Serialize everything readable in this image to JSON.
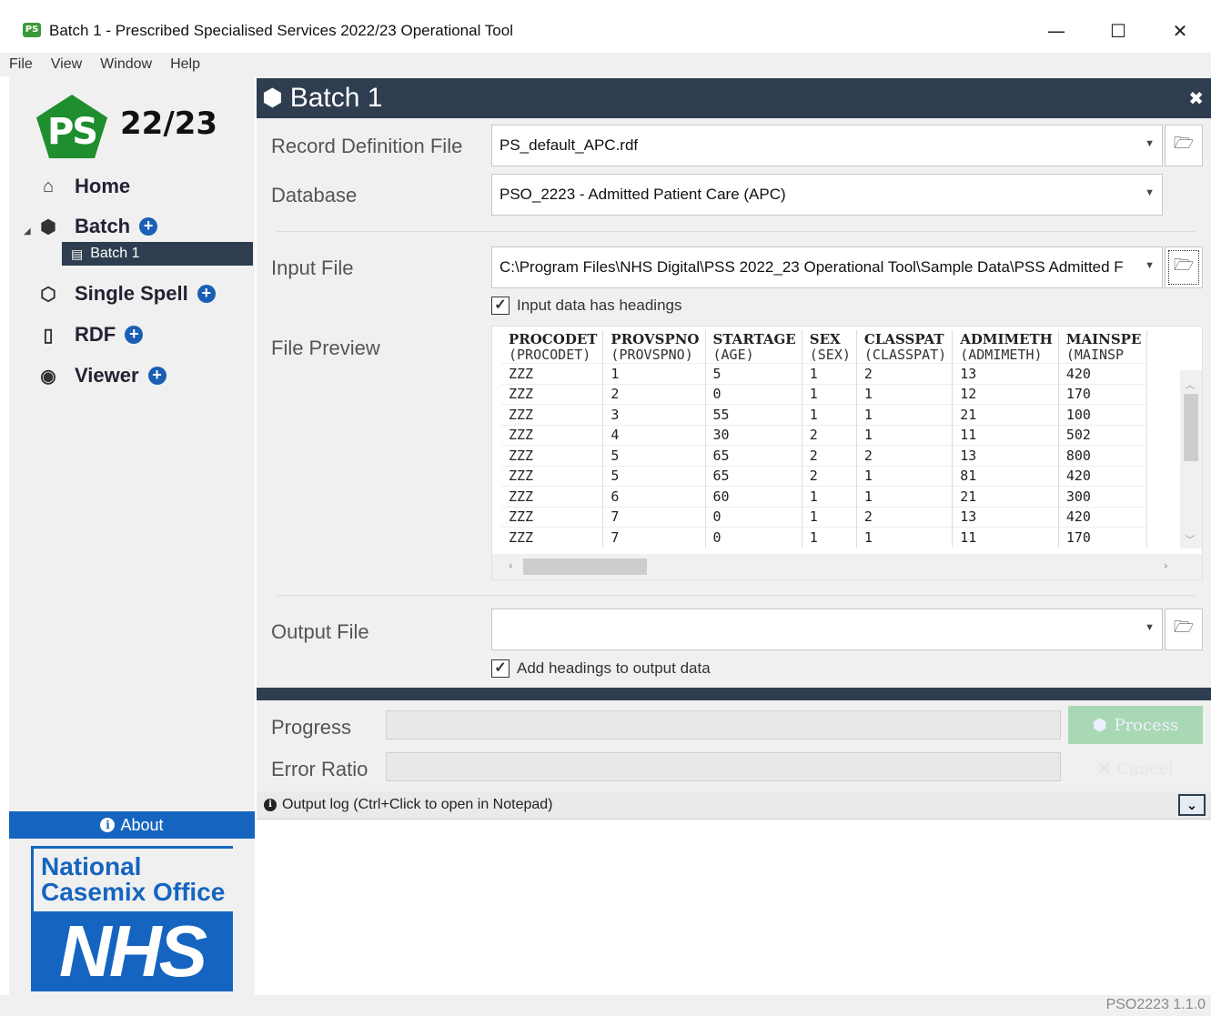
{
  "window": {
    "app_badge": "PS",
    "title": "Batch 1 - Prescribed Specialised Services 2022/23 Operational Tool",
    "controls": {
      "minimize": "—",
      "maximize": "☐",
      "close": "✕"
    }
  },
  "menu": [
    "File",
    "View",
    "Window",
    "Help"
  ],
  "sidebar": {
    "logo_text": "PS",
    "logo_year": "22/23",
    "items": [
      {
        "label": "Home",
        "icon": "home-icon"
      },
      {
        "label": "Batch",
        "icon": "cubes-icon",
        "expanded": true
      },
      {
        "label": "Single Spell",
        "icon": "cube-icon"
      },
      {
        "label": "RDF",
        "icon": "file-icon"
      },
      {
        "label": "Viewer",
        "icon": "eye-icon"
      }
    ],
    "batch_children": [
      "Batch 1"
    ],
    "about_label": "About",
    "nco_logo": [
      "National",
      "Casemix Office"
    ],
    "nhs_logo": "NHS"
  },
  "panel": {
    "title": "Batch 1",
    "record_definition_label": "Record Definition File",
    "record_definition_value": "PS_default_APC.rdf",
    "database_label": "Database",
    "database_value": "PSO_2223 - Admitted Patient Care (APC)",
    "input_file_label": "Input File",
    "input_file_value": "C:\\Program Files\\NHS Digital\\PSS 2022_23 Operational Tool\\Sample Data\\PSS Admitted F",
    "input_headings_label": "Input data has headings",
    "input_headings_checked": true,
    "file_preview_label": "File Preview",
    "output_file_label": "Output File",
    "output_file_value": "",
    "output_headings_label": "Add headings to output data",
    "output_headings_checked": true,
    "progress_label": "Progress",
    "progress_value": 0,
    "error_ratio_label": "Error Ratio",
    "error_ratio_value": 0,
    "process_label": "Process",
    "cancel_label": "Cancel",
    "log_label": "Output log (Ctrl+Click to open in Notepad)",
    "log_toggle": "⌄"
  },
  "preview": {
    "columns": [
      {
        "name": "PROCODET",
        "mapped": "(PROCODET)"
      },
      {
        "name": "PROVSPNO",
        "mapped": "(PROVSPNO)"
      },
      {
        "name": "STARTAGE",
        "mapped": "(AGE)"
      },
      {
        "name": "SEX",
        "mapped": "(SEX)"
      },
      {
        "name": "CLASSPAT",
        "mapped": "(CLASSPAT)"
      },
      {
        "name": "ADMIMETH",
        "mapped": "(ADMIMETH)"
      },
      {
        "name": "MAINSPE",
        "mapped": "(MAINSP"
      }
    ],
    "rows": [
      [
        "ZZZ",
        "1",
        "5",
        "1",
        "2",
        "13",
        "420"
      ],
      [
        "ZZZ",
        "2",
        "0",
        "1",
        "1",
        "12",
        "170"
      ],
      [
        "ZZZ",
        "3",
        "55",
        "1",
        "1",
        "21",
        "100"
      ],
      [
        "ZZZ",
        "4",
        "30",
        "2",
        "1",
        "11",
        "502"
      ],
      [
        "ZZZ",
        "5",
        "65",
        "2",
        "2",
        "13",
        "800"
      ],
      [
        "ZZZ",
        "5",
        "65",
        "2",
        "1",
        "81",
        "420"
      ],
      [
        "ZZZ",
        "6",
        "60",
        "1",
        "1",
        "21",
        "300"
      ],
      [
        "ZZZ",
        "7",
        "0",
        "1",
        "2",
        "13",
        "420"
      ],
      [
        "ZZZ",
        "7",
        "0",
        "1",
        "1",
        "11",
        "170"
      ]
    ]
  },
  "status": {
    "version": "PSO2223 1.1.0"
  }
}
